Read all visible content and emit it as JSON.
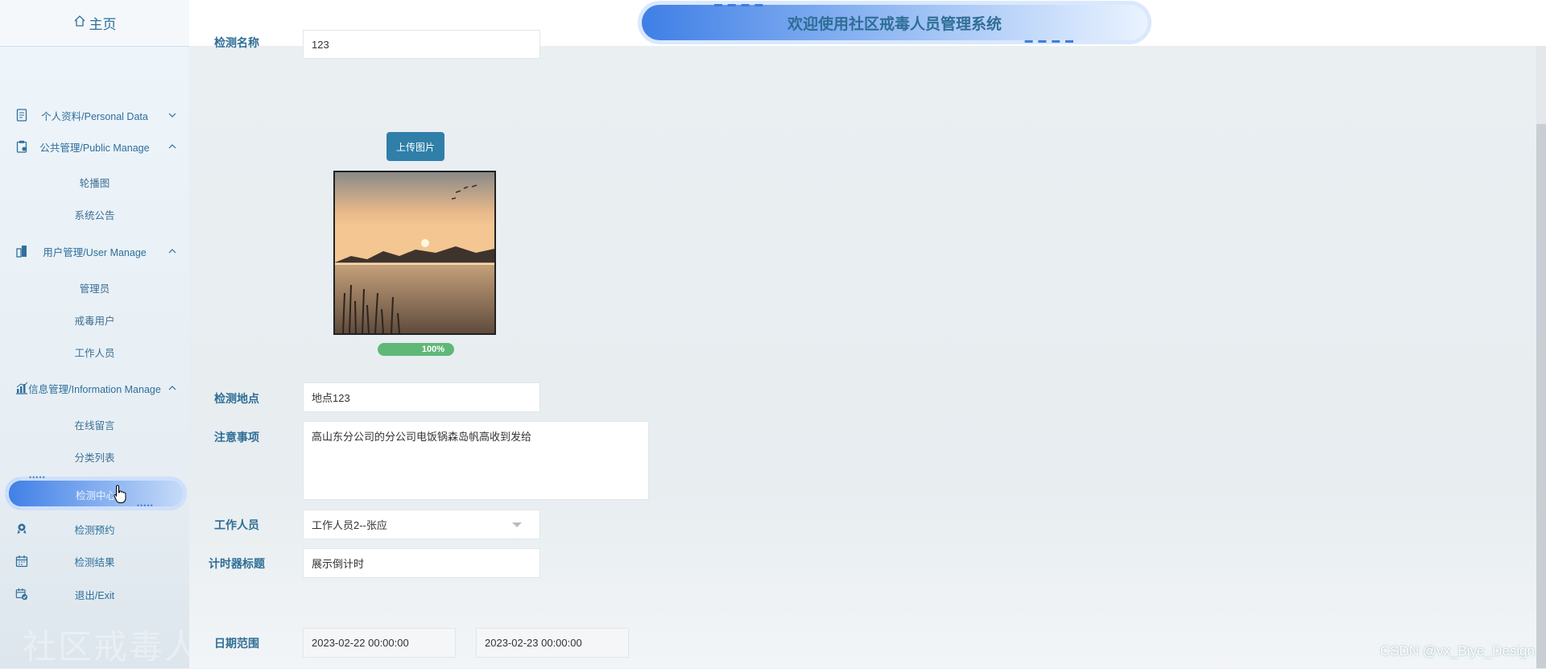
{
  "sidebar": {
    "home_label": "主页",
    "items": [
      {
        "label": "个人资料/Personal Data",
        "icon": "document-icon"
      },
      {
        "label": "公共管理/Public Manage",
        "icon": "clipboard-icon"
      },
      {
        "label": "轮播图"
      },
      {
        "label": "系统公告"
      },
      {
        "label": "用户管理/User Manage",
        "icon": "building-icon"
      },
      {
        "label": "管理员"
      },
      {
        "label": "戒毒用户"
      },
      {
        "label": "工作人员"
      },
      {
        "label": "信息管理/Information Manage",
        "icon": "chart-icon"
      },
      {
        "label": "在线留言"
      },
      {
        "label": "分类列表"
      },
      {
        "label": "检测中心"
      },
      {
        "label": "检测预约",
        "icon": "badge-icon"
      },
      {
        "label": "检测结果",
        "icon": "calendar-icon"
      },
      {
        "label": "退出/Exit",
        "icon": "calendar-check-icon"
      }
    ],
    "watermark": "社区戒毒人员管理系统后台"
  },
  "header": {
    "title": "欢迎使用社区戒毒人员管理系统"
  },
  "form": {
    "top_label": "检测名称",
    "top_value": "123",
    "upload_label": "上传图片",
    "progress": "100%",
    "location_label": "检测地点",
    "location_value": "地点123",
    "notes_label": "注意事项",
    "notes_value": "高山东分公司的分公司电饭锅森岛帆高收到发给",
    "staff_label": "工作人员",
    "staff_value": "工作人员2--张应",
    "timer_label": "计时器标题",
    "timer_value": "展示倒计时",
    "date_label": "日期范围",
    "date_start": "2023-02-22 00:00:00",
    "date_end": "2023-02-23 00:00:00"
  },
  "credit": "CSDN @vx_Biye_Design",
  "colors": {
    "accent": "#2f7fa9",
    "progress": "#5fb878",
    "label": "#2f6e96"
  }
}
